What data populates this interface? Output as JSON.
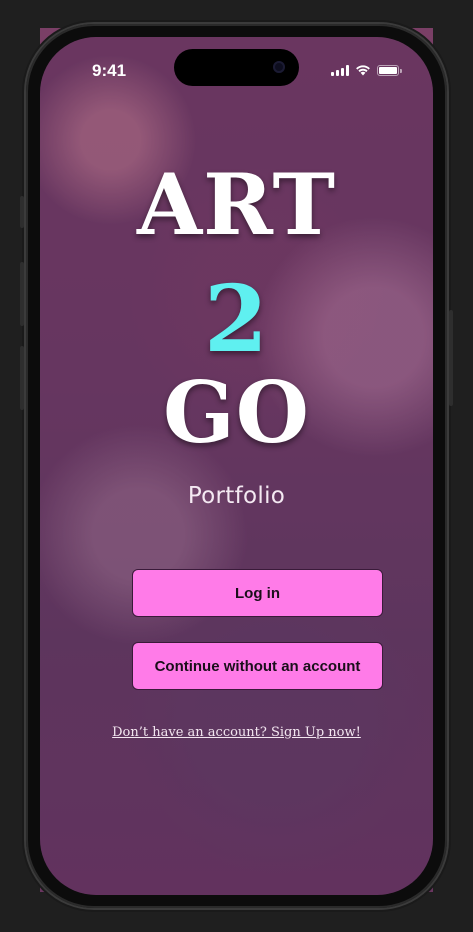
{
  "status_bar": {
    "time": "9:41"
  },
  "logo": {
    "line1": "ART",
    "line2": "2",
    "line3": "GO",
    "accent_color": "#5ff0f0"
  },
  "subtitle": "Portfolio",
  "actions": {
    "login_label": "Log in",
    "guest_label": "Continue without an account",
    "signup_link": "Don’t have an account? Sign Up now!"
  },
  "colors": {
    "button_bg": "#ff7be8",
    "overlay": "#6a3a63"
  },
  "icons": [
    "signal-icon",
    "wifi-icon",
    "battery-icon"
  ]
}
